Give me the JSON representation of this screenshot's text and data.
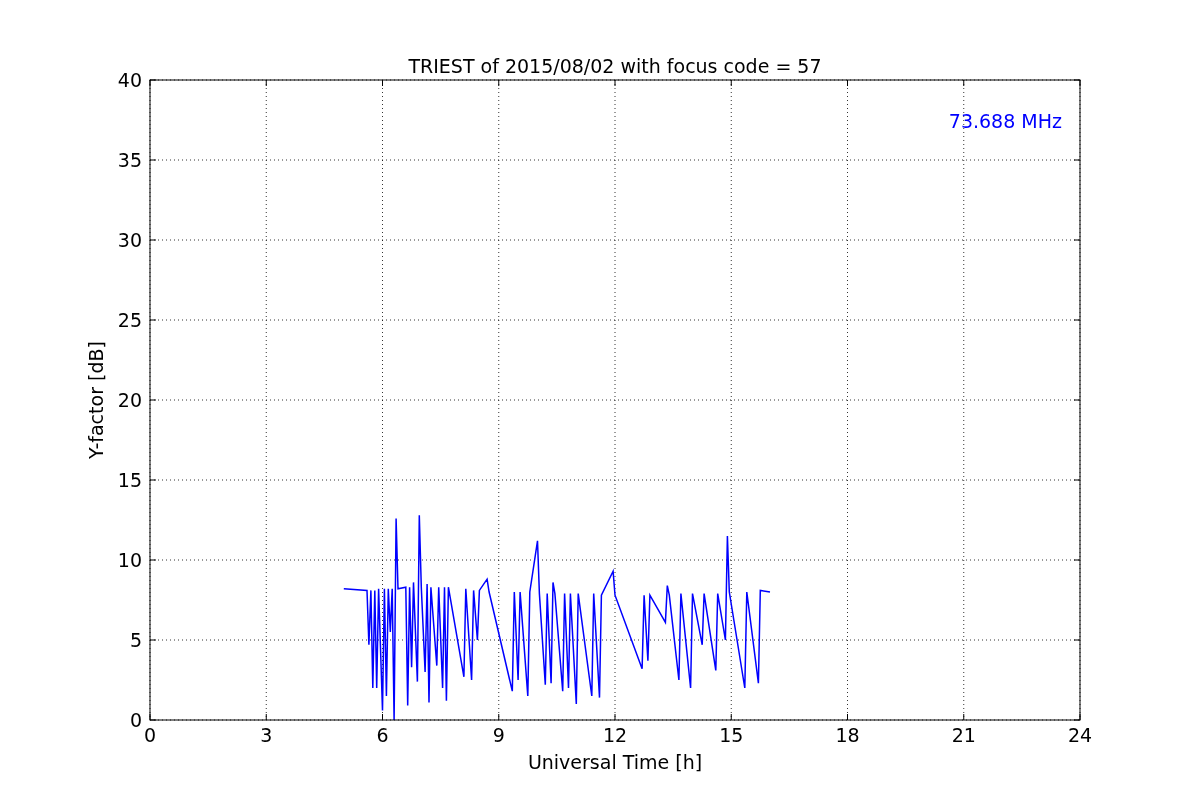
{
  "chart_data": {
    "type": "line",
    "title": "TRIEST of 2015/08/02 with focus code = 57",
    "xlabel": "Universal Time [h]",
    "ylabel": "Y-factor [dB]",
    "xlim": [
      0,
      24
    ],
    "ylim": [
      0,
      40
    ],
    "xticks": [
      0,
      3,
      6,
      9,
      12,
      15,
      18,
      21,
      24
    ],
    "yticks": [
      0,
      5,
      10,
      15,
      20,
      25,
      30,
      35,
      40
    ],
    "x": [
      5.0,
      5.6,
      5.65,
      5.7,
      5.75,
      5.8,
      5.85,
      5.9,
      6.0,
      6.05,
      6.1,
      6.15,
      6.2,
      6.25,
      6.3,
      6.35,
      6.4,
      6.6,
      6.65,
      6.7,
      6.75,
      6.8,
      6.9,
      6.95,
      7.0,
      7.1,
      7.15,
      7.2,
      7.25,
      7.4,
      7.45,
      7.55,
      7.6,
      7.65,
      7.7,
      8.1,
      8.15,
      8.3,
      8.35,
      8.45,
      8.5,
      8.7,
      8.75,
      9.35,
      9.4,
      9.5,
      9.55,
      9.75,
      9.8,
      10.0,
      10.05,
      10.2,
      10.25,
      10.35,
      10.4,
      10.45,
      10.65,
      10.7,
      10.8,
      10.85,
      11.0,
      11.05,
      11.4,
      11.45,
      11.6,
      11.65,
      11.95,
      12.0,
      12.7,
      12.75,
      12.85,
      12.9,
      13.3,
      13.35,
      13.4,
      13.65,
      13.7,
      13.95,
      14.0,
      14.25,
      14.3,
      14.6,
      14.65,
      14.85,
      14.9,
      14.95,
      15.35,
      15.4,
      15.7,
      15.75,
      16.0
    ],
    "series": [
      {
        "name": "73.688 MHz",
        "color": "#0000ff",
        "values": [
          8.2,
          8.1,
          4.7,
          8.1,
          2.0,
          8.1,
          2.0,
          8.2,
          0.6,
          8.2,
          1.5,
          8.2,
          5.5,
          8.2,
          0.0,
          12.6,
          8.2,
          8.3,
          0.9,
          8.3,
          3.3,
          8.6,
          2.4,
          12.8,
          8.3,
          3.0,
          8.5,
          1.1,
          8.3,
          3.4,
          8.3,
          2.0,
          8.3,
          1.2,
          8.3,
          2.7,
          8.2,
          2.5,
          8.1,
          5.0,
          8.1,
          8.8,
          8.0,
          1.8,
          8.0,
          2.5,
          8.0,
          1.5,
          8.0,
          11.2,
          7.9,
          2.2,
          7.9,
          2.3,
          8.6,
          7.9,
          1.8,
          7.9,
          2.0,
          7.9,
          1.0,
          7.9,
          1.5,
          7.9,
          1.4,
          7.8,
          9.3,
          7.8,
          3.2,
          7.8,
          3.7,
          7.8,
          6.1,
          8.4,
          7.8,
          2.5,
          7.9,
          2.0,
          7.9,
          4.7,
          7.9,
          3.1,
          7.9,
          5.0,
          11.5,
          8.0,
          2.0,
          8.0,
          2.3,
          8.1,
          8.0
        ]
      }
    ],
    "grid": true
  }
}
